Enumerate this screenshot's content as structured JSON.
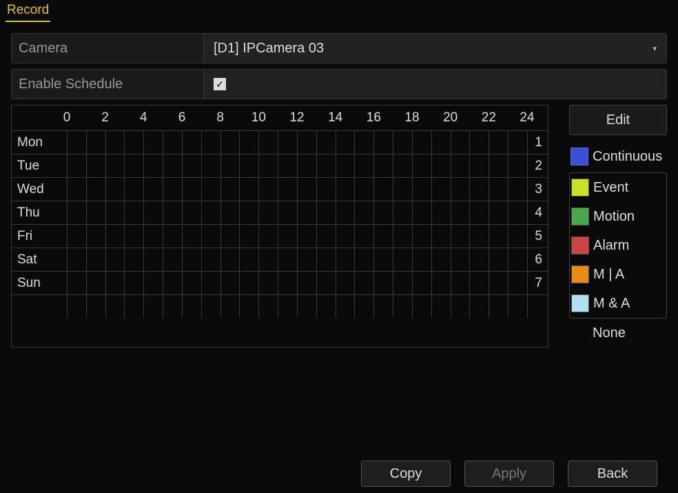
{
  "tab": {
    "label": "Record"
  },
  "form": {
    "camera": {
      "label": "Camera",
      "value": "[D1] IPCamera 03"
    },
    "enable": {
      "label": "Enable Schedule",
      "checked": true
    }
  },
  "schedule": {
    "hours": [
      "0",
      "2",
      "4",
      "6",
      "8",
      "10",
      "12",
      "14",
      "16",
      "18",
      "20",
      "22",
      "24"
    ],
    "days": [
      {
        "name": "Mon",
        "num": "1"
      },
      {
        "name": "Tue",
        "num": "2"
      },
      {
        "name": "Wed",
        "num": "3"
      },
      {
        "name": "Thu",
        "num": "4"
      },
      {
        "name": "Fri",
        "num": "5"
      },
      {
        "name": "Sat",
        "num": "6"
      },
      {
        "name": "Sun",
        "num": "7"
      }
    ]
  },
  "side": {
    "edit": "Edit",
    "legend": {
      "continuous": "Continuous",
      "event": "Event",
      "motion": "Motion",
      "alarm": "Alarm",
      "m_or_a": "M | A",
      "m_and_a": "M & A",
      "none": "None"
    }
  },
  "buttons": {
    "copy": "Copy",
    "apply": "Apply",
    "back": "Back"
  }
}
